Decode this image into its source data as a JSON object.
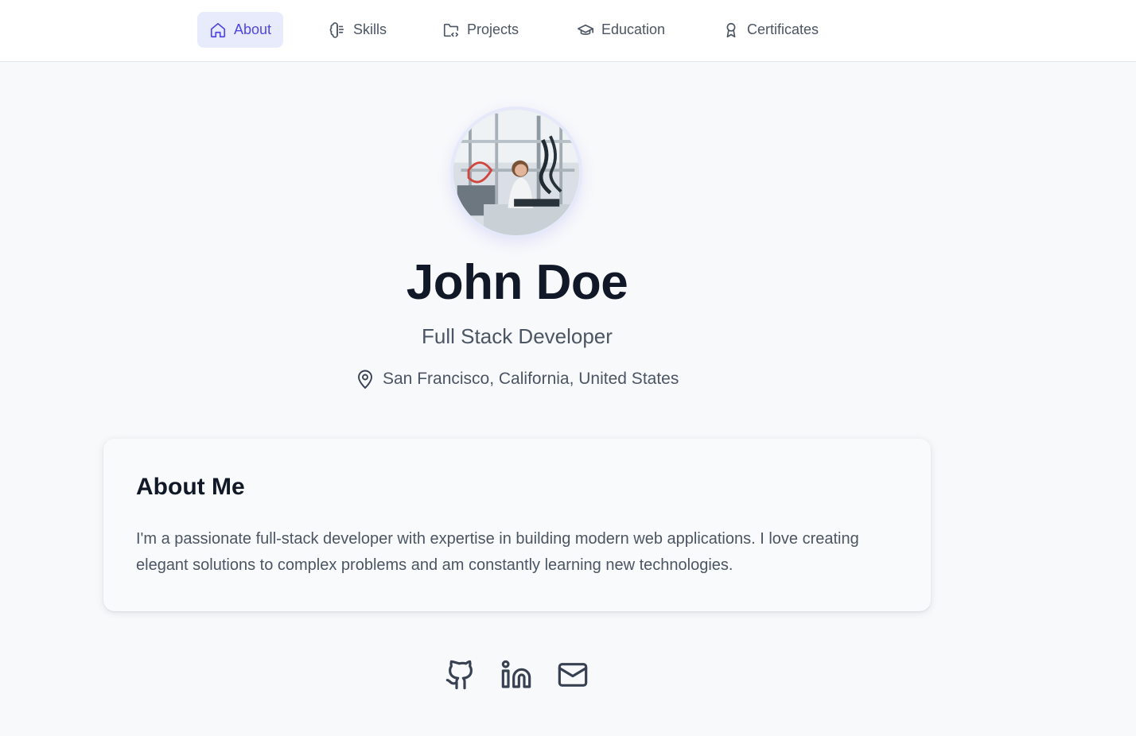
{
  "nav": {
    "items": [
      {
        "label": "About",
        "icon": "home-icon",
        "active": true
      },
      {
        "label": "Skills",
        "icon": "brain-icon",
        "active": false
      },
      {
        "label": "Projects",
        "icon": "folder-code-icon",
        "active": false
      },
      {
        "label": "Education",
        "icon": "graduation-cap-icon",
        "active": false
      },
      {
        "label": "Certificates",
        "icon": "award-icon",
        "active": false
      }
    ]
  },
  "profile": {
    "name": "John Doe",
    "role": "Full Stack Developer",
    "location": "San Francisco, California, United States",
    "location_icon": "map-pin-icon",
    "avatar_alt": "profile-photo"
  },
  "about": {
    "title": "About Me",
    "text": "I'm a passionate full-stack developer with expertise in building modern web applications. I love creating elegant solutions to complex problems and am constantly learning new technologies."
  },
  "social": {
    "links": [
      {
        "name": "GitHub",
        "icon": "github-icon"
      },
      {
        "name": "LinkedIn",
        "icon": "linkedin-icon"
      },
      {
        "name": "Email",
        "icon": "mail-icon"
      }
    ]
  },
  "colors": {
    "accent": "#4f46e5",
    "accent_bg": "#e8ebfb",
    "text_primary": "#111827",
    "text_secondary": "#4b5563",
    "page_bg": "#f8f9fb"
  }
}
